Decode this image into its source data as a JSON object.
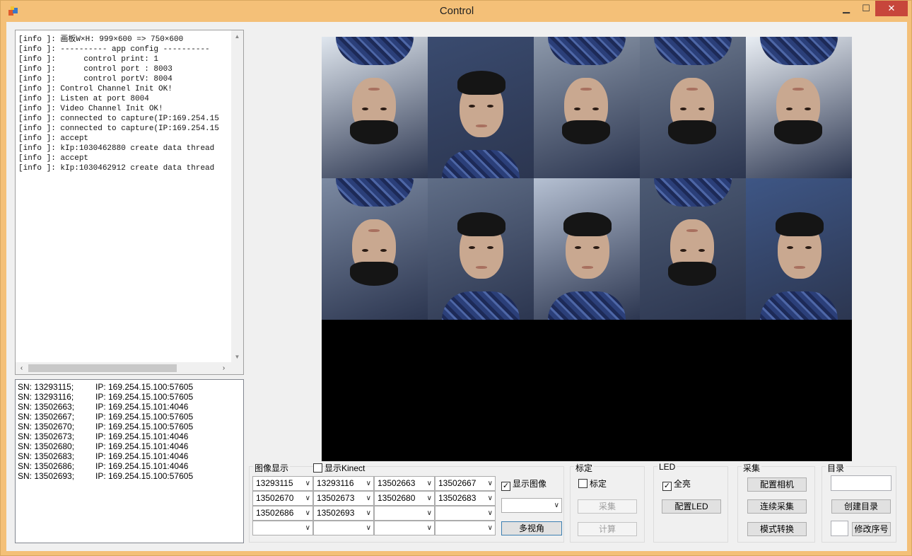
{
  "window": {
    "title": "Control",
    "minimize": "▁",
    "maximize": "☐",
    "close": "✕"
  },
  "log": {
    "lines": [
      "[info ]: 画板W×H: 999×600 => 750×600",
      "[info ]: ---------- app config ----------",
      "[info ]:      control print: 1",
      "[info ]:      control port : 8003",
      "[info ]:      control portV: 8004",
      "[info ]: Control Channel Init OK!",
      "[info ]: Listen at port 8004",
      "[info ]: Video Channel Init OK!",
      "[info ]: connected to capture(IP:169.254.15",
      "[info ]: connected to capture(IP:169.254.15",
      "[info ]: accept",
      "[info ]: kIp:1030462880 create data thread",
      "[info ]: accept",
      "[info ]: kIp:1030462912 create data thread"
    ]
  },
  "devices": [
    {
      "sn": "SN: 13293115;",
      "ip": "IP: 169.254.15.100:57605"
    },
    {
      "sn": "SN: 13293116;",
      "ip": "IP: 169.254.15.100:57605"
    },
    {
      "sn": "SN: 13502663;",
      "ip": "IP: 169.254.15.101:4046"
    },
    {
      "sn": "SN: 13502667;",
      "ip": "IP: 169.254.15.100:57605"
    },
    {
      "sn": "SN: 13502670;",
      "ip": "IP: 169.254.15.100:57605"
    },
    {
      "sn": "SN: 13502673;",
      "ip": "IP: 169.254.15.101:4046"
    },
    {
      "sn": "SN: 13502680;",
      "ip": "IP: 169.254.15.101:4046"
    },
    {
      "sn": "SN: 13502683;",
      "ip": "IP: 169.254.15.101:4046"
    },
    {
      "sn": "SN: 13502686;",
      "ip": "IP: 169.254.15.101:4046"
    },
    {
      "sn": "SN: 13502693;",
      "ip": "IP: 169.254.15.100:57605"
    }
  ],
  "image_display": {
    "group_label": "图像显示",
    "kinect_label": "显示Kinect",
    "kinect_checked": false,
    "combos": [
      [
        "13293115",
        "13293116",
        "13502663",
        "13502667"
      ],
      [
        "13502670",
        "13502673",
        "13502680",
        "13502683"
      ],
      [
        "13502686",
        "13502693",
        "",
        ""
      ],
      [
        "",
        "",
        "",
        ""
      ]
    ],
    "show_image_label": "显示图像",
    "show_image_checked": true,
    "extra_combo": "",
    "multi_view_button": "多视角"
  },
  "calibration": {
    "group_label": "标定",
    "checkbox_label": "标定",
    "checked": false,
    "collect_button": "采集",
    "compute_button": "计算"
  },
  "led": {
    "group_label": "LED",
    "full_bright_label": "全亮",
    "full_bright_checked": true,
    "config_button": "配置LED"
  },
  "capture": {
    "group_label": "采集",
    "config_camera_button": "配置相机",
    "continuous_button": "连续采集",
    "mode_switch_button": "模式转换"
  },
  "directory": {
    "group_label": "目录",
    "path_value": "",
    "create_button": "创建目录",
    "seq_value": "",
    "modify_seq_button": "修改序号"
  },
  "camera_tiles": [
    {
      "orientation": "upside-down",
      "bg": "#dfe6ee"
    },
    {
      "orientation": "upright",
      "bg": "#3a4b6f"
    },
    {
      "orientation": "upside-down",
      "bg": "#8c98aa"
    },
    {
      "orientation": "upside-down",
      "bg": "#6e7b90"
    },
    {
      "orientation": "upside-down",
      "bg": "#e9eef4"
    },
    {
      "orientation": "upside-down",
      "bg": "#7c8aa2"
    },
    {
      "orientation": "upright",
      "bg": "#5f6d86"
    },
    {
      "orientation": "upright",
      "bg": "#b5c0d2"
    },
    {
      "orientation": "upside-down",
      "bg": "#4c5a73"
    },
    {
      "orientation": "upright",
      "bg": "#3e5685"
    }
  ]
}
